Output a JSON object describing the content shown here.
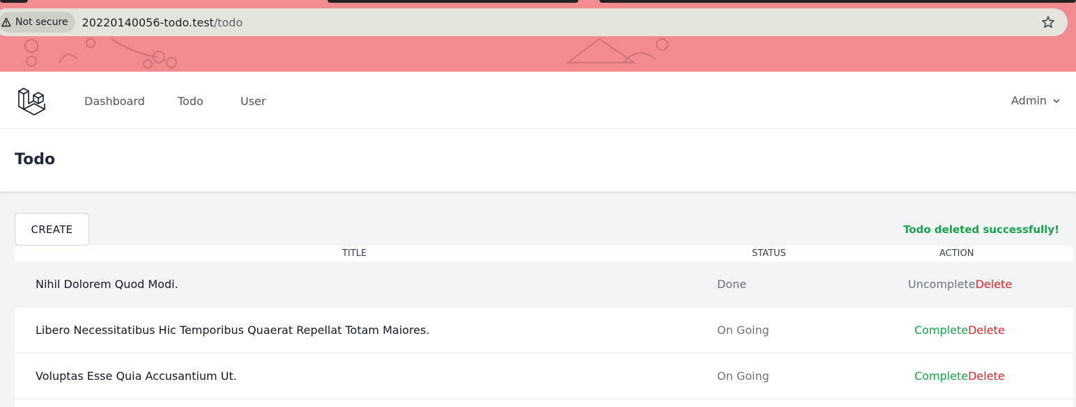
{
  "browser": {
    "security_label": "Not secure",
    "url_host": "20220140056-todo.test",
    "url_path": "/todo"
  },
  "nav": {
    "links": [
      "Dashboard",
      "Todo",
      "User"
    ],
    "user": "Admin"
  },
  "header": {
    "title": "Todo"
  },
  "actions": {
    "create_label": "CREATE"
  },
  "flash": {
    "message": "Todo deleted successfully!"
  },
  "table": {
    "headers": [
      "TITLE",
      "STATUS",
      "ACTION"
    ],
    "rows": [
      {
        "title": "Nihil Dolorem Quod Modi.",
        "status": "Done",
        "toggle": "Uncomplete",
        "delete": "Delete"
      },
      {
        "title": "Libero Necessitatibus Hic Temporibus Quaerat Repellat Totam Maiores.",
        "status": "On Going",
        "toggle": "Complete",
        "delete": "Delete"
      },
      {
        "title": "Voluptas Esse Quia Accusantium Ut.",
        "status": "On Going",
        "toggle": "Complete",
        "delete": "Delete"
      }
    ]
  },
  "colors": {
    "success": "#16a34a",
    "danger": "#dc2626",
    "muted": "#6b7280",
    "browser_theme": "#f28b8f"
  },
  "icons": {
    "security": "warning-triangle-icon",
    "bookmark": "star-icon",
    "logo": "laravel-logo-icon",
    "user_menu": "chevron-down-icon"
  }
}
